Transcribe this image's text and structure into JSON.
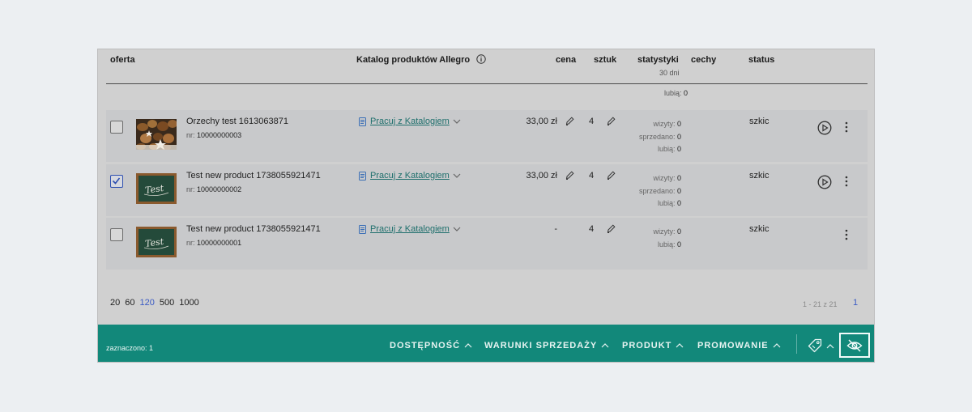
{
  "header": {
    "oferta": "oferta",
    "katalog": "Katalog produktów Allegro",
    "cena": "cena",
    "sztuk": "sztuk",
    "statystyki": "statystyki",
    "statystyki_sub": "30 dni",
    "cechy": "cechy",
    "status": "status"
  },
  "stray": {
    "label": "lubią:",
    "value": "0"
  },
  "rows": [
    {
      "title": "Orzechy test 1613063871",
      "nr_label": "nr:",
      "nr": "10000000003",
      "catalog_link": "Pracuj z Katalogiem",
      "price": "33,00 zł",
      "qty": "4",
      "stats": [
        {
          "label": "wizyty:",
          "value": "0"
        },
        {
          "label": "sprzedano:",
          "value": "0"
        },
        {
          "label": "lubią:",
          "value": "0"
        }
      ],
      "status": "szkic",
      "checked": false
    },
    {
      "title": "Test new product 1738055921471",
      "nr_label": "nr:",
      "nr": "10000000002",
      "catalog_link": "Pracuj z Katalogiem",
      "price": "33,00 zł",
      "qty": "4",
      "stats": [
        {
          "label": "wizyty:",
          "value": "0"
        },
        {
          "label": "sprzedano:",
          "value": "0"
        },
        {
          "label": "lubią:",
          "value": "0"
        }
      ],
      "status": "szkic",
      "checked": true
    },
    {
      "title": "Test new product 1738055921471",
      "nr_label": "nr:",
      "nr": "10000000001",
      "catalog_link": "Pracuj z Katalogiem",
      "price": "-",
      "qty": "4",
      "stats": [
        {
          "label": "wizyty:",
          "value": "0"
        },
        {
          "label": "lubią:",
          "value": "0"
        }
      ],
      "status": "szkic",
      "checked": false
    }
  ],
  "page_sizes": [
    "20",
    "60",
    "120",
    "500",
    "1000"
  ],
  "page_size_active": "120",
  "pagination": {
    "info": "1 - 21 z 21",
    "current": "1"
  },
  "action_bar": {
    "selected": "zaznaczono: 1",
    "menus": [
      "DOSTĘPNOŚĆ",
      "WARUNKI SPRZEDAŻY",
      "PRODUKT",
      "PROMOWANIE"
    ]
  },
  "thumbnail_text": "Test",
  "icons": {
    "info": "info-icon",
    "catalog": "document-icon",
    "edit": "pencil-icon",
    "play": "play-circle-icon",
    "more": "kebab-icon",
    "tag": "tag-icon",
    "hide": "eye-off-icon",
    "chevron_down": "chevron-down-icon",
    "chevron_up": "chevron-up-icon"
  },
  "colors": {
    "action_bar": "#12887a",
    "link": "#1e6f6c",
    "accent_blue": "#3b5bc4",
    "overlay": "#d0d0d0"
  }
}
